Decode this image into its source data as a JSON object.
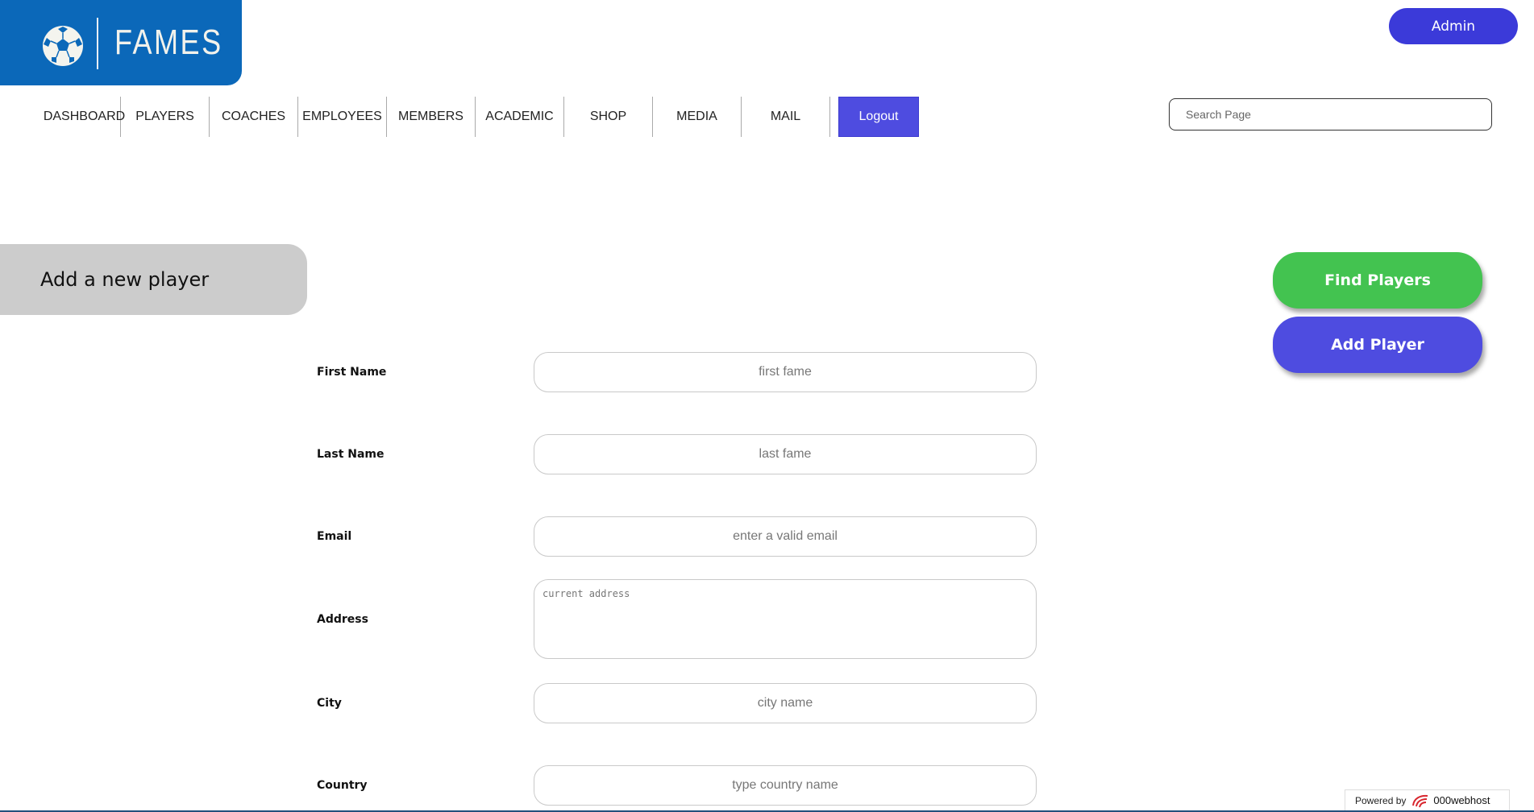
{
  "brand": {
    "name": "FAMES",
    "logo_icon": "soccer-ball-icon",
    "color": "#0b68b9"
  },
  "header": {
    "admin_label": "Admin"
  },
  "nav": {
    "items": [
      "DASHBOARD",
      "PLAYERS",
      "COACHES",
      "EMPLOYEES",
      "MEMBERS",
      "ACADEMIC",
      "SHOP",
      "MEDIA",
      "MAIL"
    ],
    "logout_label": "Logout"
  },
  "search": {
    "placeholder": "Search Page",
    "value": ""
  },
  "section": {
    "title": "Add a new player"
  },
  "actions": {
    "find_label": "Find Players",
    "add_label": "Add Player",
    "find_color": "#43c350",
    "add_color": "#4e4ce0"
  },
  "form": {
    "first_name": {
      "label": "First Name",
      "placeholder": "first fame"
    },
    "last_name": {
      "label": "Last Name",
      "placeholder": "last fame"
    },
    "email": {
      "label": "Email",
      "placeholder": "enter a valid email"
    },
    "address": {
      "label": "Address",
      "placeholder": "current address"
    },
    "city": {
      "label": "City",
      "placeholder": "city name"
    },
    "country": {
      "label": "Country",
      "placeholder": "type country name"
    }
  },
  "footer": {
    "powered_by": "Powered by",
    "host": "000webhost"
  }
}
